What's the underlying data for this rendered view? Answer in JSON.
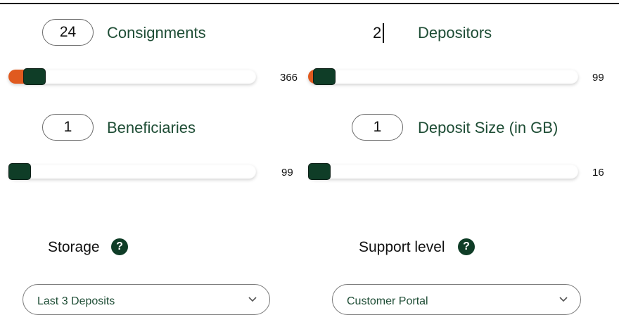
{
  "colors": {
    "accent_fill": "#e05a1f",
    "thumb": "#0f3d27",
    "label": "#1e4d35",
    "help_icon_bg": "#0f3d27"
  },
  "consignments": {
    "value": "24",
    "label": "Consignments",
    "max": "366",
    "fraction": 0.066
  },
  "depositors": {
    "value": "2",
    "label": "Depositors",
    "max": "99",
    "fraction": 0.02
  },
  "beneficiaries": {
    "value": "1",
    "label": "Beneficiaries",
    "max": "99",
    "fraction": 0.0
  },
  "deposit_size": {
    "value": "1",
    "label": "Deposit Size (in GB)",
    "max": "16",
    "fraction": 0.0
  },
  "storage": {
    "label": "Storage",
    "help_icon": "question-circle-icon",
    "help_glyph": "?",
    "selected": "Last 3 Deposits"
  },
  "support": {
    "label": "Support level",
    "help_icon": "question-circle-icon",
    "help_glyph": "?",
    "selected": "Customer Portal"
  }
}
